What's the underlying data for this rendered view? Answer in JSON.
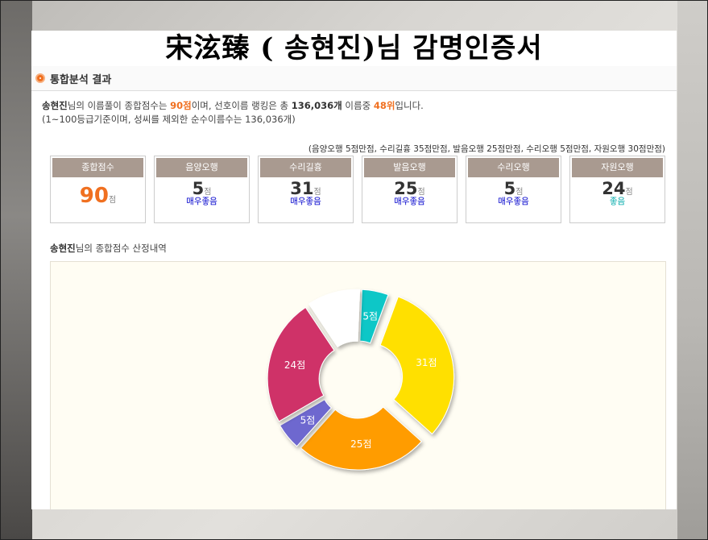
{
  "title": "宋泫臻 ( 송현진)님  감명인증서",
  "section": {
    "label": "통합분석 결과"
  },
  "summary": {
    "line1": {
      "name": "송현진",
      "t1": "님의 이름풀이 종합점수는 ",
      "score": "90점",
      "t2": "이며, 선호이름 랭킹은 총 ",
      "total": "136,036개",
      "t3": " 이름중 ",
      "rank": "48위",
      "t4": "입니다."
    },
    "line2": "(1~100등급기준이며, 성씨를 제외한 순수이름수는 136,036개)"
  },
  "criteria": "(음양오행 5점만점, 수리길흉 35점만점, 발음오행 25점만점, 수리오행 5점만점, 자원오행 30점만점)",
  "cards": [
    {
      "label": "종합점수",
      "value": "90",
      "unit": "점",
      "grade": ""
    },
    {
      "label": "음양오행",
      "value": "5",
      "unit": "점",
      "grade": "매우좋음",
      "grade_color": "#0000cc"
    },
    {
      "label": "수리길흉",
      "value": "31",
      "unit": "점",
      "grade": "매우좋음",
      "grade_color": "#0000cc"
    },
    {
      "label": "발음오행",
      "value": "25",
      "unit": "점",
      "grade": "매우좋음",
      "grade_color": "#0000cc"
    },
    {
      "label": "수리오행",
      "value": "5",
      "unit": "점",
      "grade": "매우좋음",
      "grade_color": "#0000cc"
    },
    {
      "label": "자원오행",
      "value": "24",
      "unit": "점",
      "grade": "좋음",
      "grade_color": "#00aaaa"
    }
  ],
  "breakdown": {
    "name": "송현진",
    "text": "님의 종합점수 산정내역"
  },
  "chart_data": {
    "type": "pie",
    "title": "",
    "slices": [
      {
        "label": "5점",
        "value": 5,
        "color": "#11c7c7"
      },
      {
        "label": "31점",
        "value": 31,
        "color": "#ffe000"
      },
      {
        "label": "25점",
        "value": 25,
        "color": "#ff9c00"
      },
      {
        "label": "5점",
        "value": 5,
        "color": "#6e67cf"
      },
      {
        "label": "24점",
        "value": 24,
        "color": "#cf3367"
      },
      {
        "label": "",
        "value": 10,
        "color": "#ffffff"
      }
    ]
  }
}
